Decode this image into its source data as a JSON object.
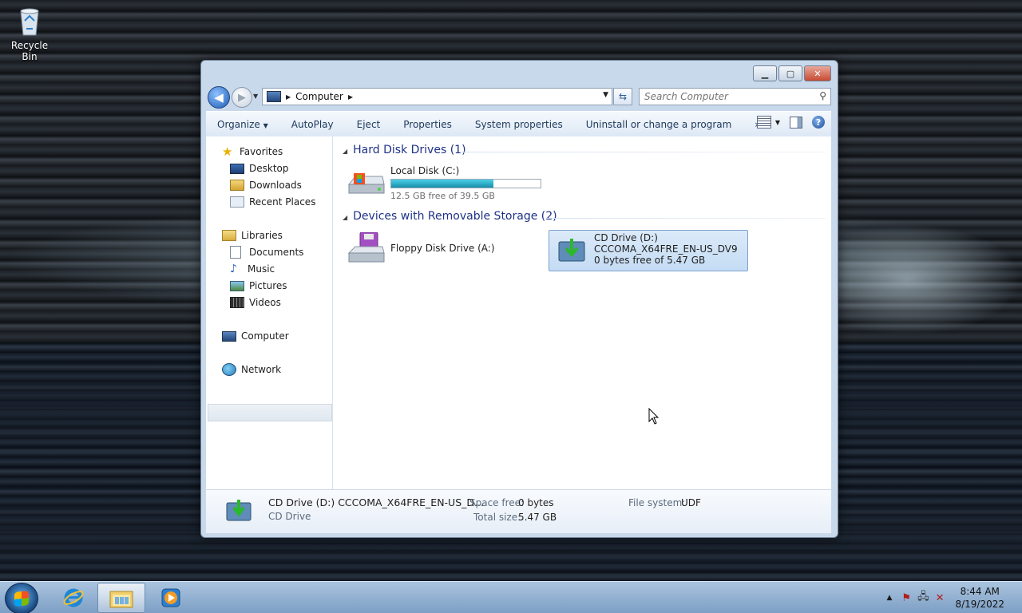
{
  "desktop": {
    "recycle_bin_label": "Recycle Bin"
  },
  "window": {
    "address": {
      "crumb": "Computer"
    },
    "search": {
      "placeholder": "Search Computer"
    },
    "toolbar": {
      "organize": "Organize",
      "autoplay": "AutoPlay",
      "eject": "Eject",
      "properties": "Properties",
      "system_properties": "System properties",
      "uninstall": "Uninstall or change a program",
      "more": "»"
    },
    "nav": {
      "favorites": "Favorites",
      "desktop": "Desktop",
      "downloads": "Downloads",
      "recent_places": "Recent Places",
      "libraries": "Libraries",
      "documents": "Documents",
      "music": "Music",
      "pictures": "Pictures",
      "videos": "Videos",
      "computer": "Computer",
      "network": "Network"
    },
    "groups": {
      "hdd": "Hard Disk Drives (1)",
      "removable": "Devices with Removable Storage (2)"
    },
    "drives": {
      "c": {
        "name": "Local Disk (C:)",
        "free": "12.5 GB free of 39.5 GB",
        "used_fraction": 0.684
      },
      "a": {
        "name": "Floppy Disk Drive (A:)"
      },
      "d": {
        "name": "CD Drive (D:)",
        "label": "CCCOMA_X64FRE_EN-US_DV9",
        "free": "0 bytes free of 5.47 GB"
      }
    },
    "details": {
      "title": "CD Drive (D:) CCCOMA_X64FRE_EN-US_D...",
      "type": "CD Drive",
      "space_free_label": "Space free:",
      "space_free": "0 bytes",
      "total_size_label": "Total size:",
      "total_size": "5.47 GB",
      "filesystem_label": "File system:",
      "filesystem": "UDF"
    }
  },
  "taskbar": {
    "time": "8:44 AM",
    "date": "8/19/2022"
  }
}
